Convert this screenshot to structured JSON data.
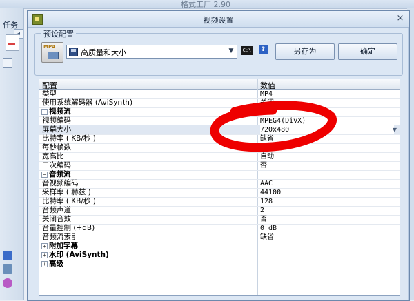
{
  "background_app": {
    "title": "格式工厂 2.90",
    "side_label": "任务"
  },
  "dialog": {
    "title": "视频设置",
    "close_symbol": "×"
  },
  "preset": {
    "group_label": "预设配置",
    "format_badge": "MP4",
    "selected": "高质量和大小",
    "cmd_label": "C:\\",
    "help_label": "?",
    "save_as_label": "另存为",
    "ok_label": "确定"
  },
  "grid": {
    "header_config": "配置",
    "header_value": "数值",
    "rows": [
      {
        "label": "类型",
        "value": "MP4",
        "indent": 0,
        "kind": "item"
      },
      {
        "label": "使用系统解码器 (AviSynth)",
        "value": "关闭",
        "indent": 0,
        "kind": "item"
      },
      {
        "label": "视频流",
        "value": "",
        "indent": 0,
        "kind": "section",
        "toggle": "−"
      },
      {
        "label": "视频编码",
        "value": "MPEG4(DivX)",
        "indent": 1,
        "kind": "item"
      },
      {
        "label": "屏幕大小",
        "value": "720x480",
        "indent": 1,
        "kind": "item",
        "selected": true
      },
      {
        "label": "比特率 ( KB/秒 )",
        "value": "缺省",
        "indent": 1,
        "kind": "item"
      },
      {
        "label": "每秒帧数",
        "value": "",
        "indent": 1,
        "kind": "item"
      },
      {
        "label": "宽高比",
        "value": "自动",
        "indent": 1,
        "kind": "item"
      },
      {
        "label": "二次编码",
        "value": "否",
        "indent": 1,
        "kind": "item"
      },
      {
        "label": "音频流",
        "value": "",
        "indent": 0,
        "kind": "section",
        "toggle": "−"
      },
      {
        "label": "音视频编码",
        "value": "AAC",
        "indent": 1,
        "kind": "item"
      },
      {
        "label": "采样率 ( 赫兹 )",
        "value": "44100",
        "indent": 1,
        "kind": "item"
      },
      {
        "label": "比特率 ( KB/秒 )",
        "value": "128",
        "indent": 1,
        "kind": "item"
      },
      {
        "label": "音频声道",
        "value": "2",
        "indent": 1,
        "kind": "item"
      },
      {
        "label": "关闭音效",
        "value": "否",
        "indent": 1,
        "kind": "item"
      },
      {
        "label": "音量控制 (+dB)",
        "value": "0 dB",
        "indent": 1,
        "kind": "item"
      },
      {
        "label": "音频流索引",
        "value": "缺省",
        "indent": 1,
        "kind": "item"
      },
      {
        "label": "附加字幕",
        "value": "",
        "indent": 0,
        "kind": "section",
        "toggle": "+"
      },
      {
        "label": "水印 (AviSynth)",
        "value": "",
        "indent": 0,
        "kind": "section",
        "toggle": "+"
      },
      {
        "label": "高级",
        "value": "",
        "indent": 0,
        "kind": "section",
        "toggle": "+"
      }
    ]
  },
  "colors": {
    "dialog_bg": "#dce7f4",
    "selected_row": "#dfe7f2",
    "annotation_red": "#ee0000"
  },
  "icons": [
    "app-icon",
    "mp4-format-icon",
    "floppy-disk-icon",
    "chevron-down-icon",
    "command-prompt-icon",
    "help-icon",
    "close-icon",
    "expand-icon",
    "collapse-icon"
  ]
}
